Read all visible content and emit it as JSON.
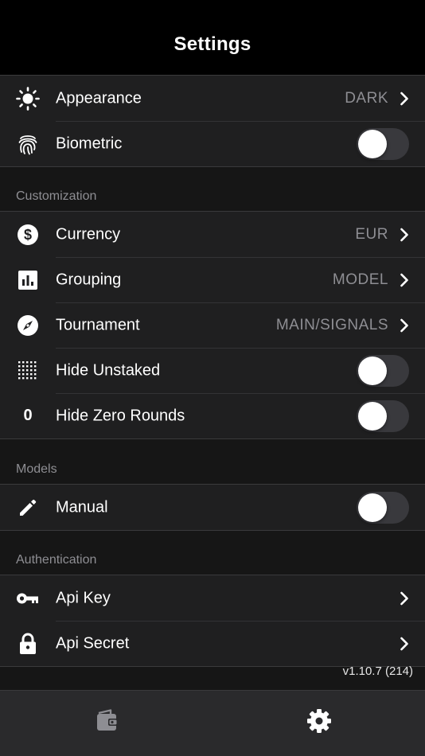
{
  "header": {
    "title": "Settings"
  },
  "general": {
    "items": [
      {
        "label": "Appearance",
        "value": "DARK",
        "icon": "sun-icon"
      },
      {
        "label": "Biometric",
        "toggle": false,
        "icon": "fingerprint-icon"
      }
    ]
  },
  "customization": {
    "title": "Customization",
    "items": [
      {
        "label": "Currency",
        "value": "EUR",
        "icon": "dollar-icon"
      },
      {
        "label": "Grouping",
        "value": "MODEL",
        "icon": "bar-chart-icon"
      },
      {
        "label": "Tournament",
        "value": "MAIN/SIGNALS",
        "icon": "compass-icon"
      },
      {
        "label": "Hide Unstaked",
        "toggle": false,
        "icon": "dot-grid-icon"
      },
      {
        "label": "Hide Zero Rounds",
        "toggle": false,
        "icon": "zero-icon",
        "icon_glyph": "0"
      }
    ]
  },
  "models": {
    "title": "Models",
    "items": [
      {
        "label": "Manual",
        "toggle": false,
        "icon": "pencil-icon"
      }
    ]
  },
  "authentication": {
    "title": "Authentication",
    "items": [
      {
        "label": "Api Key",
        "icon": "key-icon"
      },
      {
        "label": "Api Secret",
        "icon": "lock-icon"
      }
    ]
  },
  "footer": {
    "version": "v1.10.7 (214)"
  },
  "tabbar": {
    "tabs": [
      {
        "icon": "wallet-icon",
        "selected": false
      },
      {
        "icon": "gear-icon",
        "selected": true
      }
    ]
  },
  "colors": {
    "background": "#161616",
    "row": "#1f1f20",
    "secondary_text": "#8e8e93",
    "toggle_off": "#39393d",
    "tabbar": "#2a2a2c"
  }
}
